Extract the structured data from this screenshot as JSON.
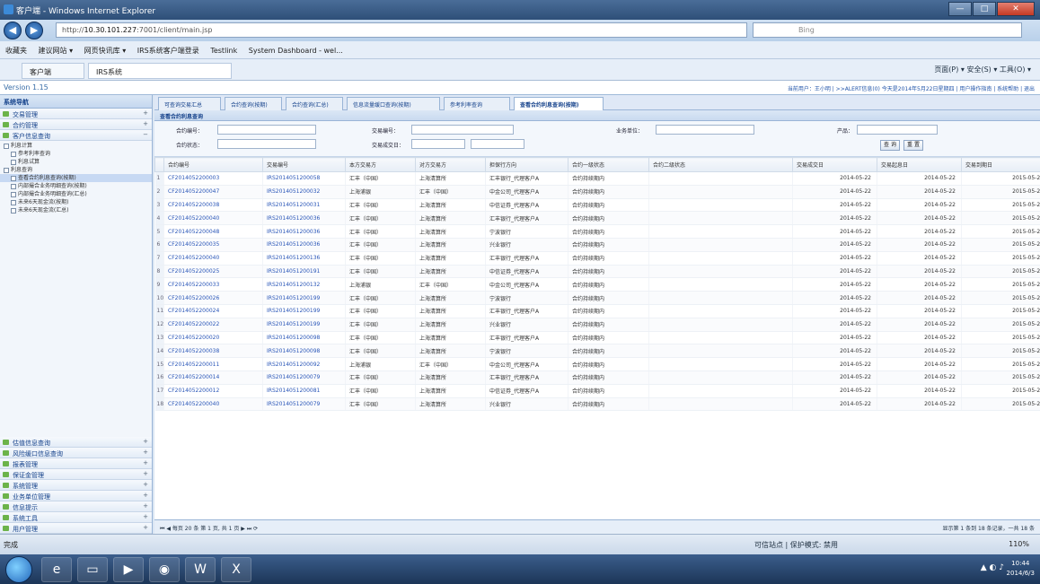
{
  "window": {
    "title": "客户端 - Windows Internet Explorer",
    "buttons": [
      "—",
      "□",
      "✕"
    ]
  },
  "address": {
    "url_prefix": "http://",
    "url_host": "10.30.101.227",
    "url_rest": ":7001/client/main.jsp",
    "search_placeholder": "Bing"
  },
  "favorites": [
    "收藏夹",
    "建议网站 ▾",
    "网页快讯库 ▾",
    "IRS系统客户端登录",
    "Testlink",
    "System Dashboard - wel..."
  ],
  "browser_tabs": [
    "客户端",
    "IRS系统"
  ],
  "browser_tools": "页面(P) ▾  安全(S) ▾  工具(O) ▾",
  "app": {
    "version": "Version 1.15",
    "welcome": "当前用户：王小明 | >>ALERT信息(0) 今天是2014年5月22日星期四 | 用户操作指南 | 系统帮助 | 退出"
  },
  "sidebar": {
    "header": "系统导航",
    "top_items": [
      "交易管理",
      "合约管理",
      "客户信息查询"
    ],
    "tree": [
      "利息计算",
      "参考利率查询",
      "利息试算",
      "利息查询",
      "查看合约利息查询(按期)",
      "内部撮合业务明细查询(按期)",
      "内部撮合业务明细查询(汇总)",
      "未来6天现金流(按期)",
      "未来6天现金流(汇总)"
    ],
    "tree_selected": 4,
    "bottom_items": [
      "估值信息查询",
      "风险缓口信息查询",
      "报表管理",
      "保证金管理",
      "系统管理",
      "业务单位管理",
      "信息提示",
      "系统工具",
      "用户管理"
    ]
  },
  "main": {
    "tabs": [
      "可查询交易汇总",
      "合约查询(按期)",
      "合约查询(汇总)",
      "信息流量缓口查询(按期)",
      "参考利率查询",
      "查看合约利息查询(按期)"
    ],
    "active_tab": 5,
    "panel_title": "查看合约利息查询",
    "filter": {
      "contract_no_label": "合约编号：",
      "trade_no_label": "交易编号：",
      "company_label": "业务单位：",
      "product_label": "产品：",
      "status_label": "合约状态：",
      "date_label": "交易成交日：",
      "query_btn": "查 询",
      "reset_btn": "重 置"
    },
    "columns": [
      "合约编号",
      "交易编号",
      "本方交易方",
      "对方交易方",
      "担保行方向",
      "合约一级状态",
      "合约二级状态",
      "交易成交日",
      "交易起息日",
      "交易到期日"
    ],
    "rows": [
      [
        "CF2014052200003",
        "IRS2014051200058",
        "汇丰（中国）",
        "上海清算所",
        "汇丰银行_代理客户A",
        "合约持续期内",
        "",
        "2014-05-22",
        "2014-05-22",
        "2015-05-22"
      ],
      [
        "CF2014052200047",
        "IRS2014051200032",
        "上海浦银",
        "汇丰（中国）",
        "中金公司_代理客户A",
        "合约持续期内",
        "",
        "2014-05-22",
        "2014-05-22",
        "2015-05-22"
      ],
      [
        "CF2014052200038",
        "IRS2014051200031",
        "汇丰（中国）",
        "上海清算所",
        "中信证券_代理客户A",
        "合约持续期内",
        "",
        "2014-05-22",
        "2014-05-22",
        "2015-05-22"
      ],
      [
        "CF2014052200040",
        "IRS2014051200036",
        "汇丰（中国）",
        "上海清算所",
        "汇丰银行_代理客户A",
        "合约持续期内",
        "",
        "2014-05-22",
        "2014-05-22",
        "2015-05-22"
      ],
      [
        "CF2014052200048",
        "IRS2014051200036",
        "汇丰（中国）",
        "上海清算所",
        "宁波银行",
        "合约持续期内",
        "",
        "2014-05-22",
        "2014-05-22",
        "2015-05-22"
      ],
      [
        "CF2014052200035",
        "IRS2014051200036",
        "汇丰（中国）",
        "上海清算所",
        "兴业银行",
        "合约持续期内",
        "",
        "2014-05-22",
        "2014-05-22",
        "2015-05-22"
      ],
      [
        "CF2014052200040",
        "IRS2014051200136",
        "汇丰（中国）",
        "上海清算所",
        "汇丰银行_代理客户A",
        "合约持续期内",
        "",
        "2014-05-22",
        "2014-05-22",
        "2015-05-22"
      ],
      [
        "CF2014052200025",
        "IRS2014051200191",
        "汇丰（中国）",
        "上海清算所",
        "中信证券_代理客户A",
        "合约持续期内",
        "",
        "2014-05-22",
        "2014-05-22",
        "2015-05-22"
      ],
      [
        "CF2014052200033",
        "IRS2014051200132",
        "上海浦银",
        "汇丰（中国）",
        "中金公司_代理客户A",
        "合约持续期内",
        "",
        "2014-05-22",
        "2014-05-22",
        "2015-05-22"
      ],
      [
        "CF2014052200026",
        "IRS2014051200199",
        "汇丰（中国）",
        "上海清算所",
        "宁波银行",
        "合约持续期内",
        "",
        "2014-05-22",
        "2014-05-22",
        "2015-05-22"
      ],
      [
        "CF2014052200024",
        "IRS2014051200199",
        "汇丰（中国）",
        "上海清算所",
        "汇丰银行_代理客户A",
        "合约持续期内",
        "",
        "2014-05-22",
        "2014-05-22",
        "2015-05-22"
      ],
      [
        "CF2014052200022",
        "IRS2014051200199",
        "汇丰（中国）",
        "上海清算所",
        "兴业银行",
        "合约持续期内",
        "",
        "2014-05-22",
        "2014-05-22",
        "2015-05-22"
      ],
      [
        "CF2014052200020",
        "IRS2014051200098",
        "汇丰（中国）",
        "上海清算所",
        "汇丰银行_代理客户A",
        "合约持续期内",
        "",
        "2014-05-22",
        "2014-05-22",
        "2015-05-22"
      ],
      [
        "CF2014052200038",
        "IRS2014051200098",
        "汇丰（中国）",
        "上海清算所",
        "宁波银行",
        "合约持续期内",
        "",
        "2014-05-22",
        "2014-05-22",
        "2015-05-22"
      ],
      [
        "CF2014052200011",
        "IRS2014051200092",
        "上海浦银",
        "汇丰（中国）",
        "中金公司_代理客户A",
        "合约持续期内",
        "",
        "2014-05-22",
        "2014-05-22",
        "2015-05-22"
      ],
      [
        "CF2014052200014",
        "IRS2014051200079",
        "汇丰（中国）",
        "上海清算所",
        "汇丰银行_代理客户A",
        "合约持续期内",
        "",
        "2014-05-22",
        "2014-05-22",
        "2015-05-22"
      ],
      [
        "CF2014052200012",
        "IRS2014051200081",
        "汇丰（中国）",
        "上海清算所",
        "中信证券_代理客户A",
        "合约持续期内",
        "",
        "2014-05-22",
        "2014-05-22",
        "2015-05-22"
      ],
      [
        "CF2014052200040",
        "IRS2014051200079",
        "汇丰（中国）",
        "上海清算所",
        "兴业银行",
        "合约持续期内",
        "",
        "2014-05-22",
        "2014-05-22",
        "2015-05-22"
      ]
    ],
    "pager": {
      "per_page": "每页 20 条",
      "page": "第 1 页, 共 1 页",
      "info": "显示第 1 条到 18 条记录，一共 18 条"
    }
  },
  "statusbar": {
    "left": "完成",
    "mode": "可信站点 | 保护模式: 禁用",
    "zoom": "110%"
  },
  "taskbar": {
    "time": "10:44",
    "date": "2014/6/3"
  },
  "colors": {
    "accent": "#15428b",
    "link": "#2a56b8",
    "sidebar_icon": "#6cb34a"
  }
}
